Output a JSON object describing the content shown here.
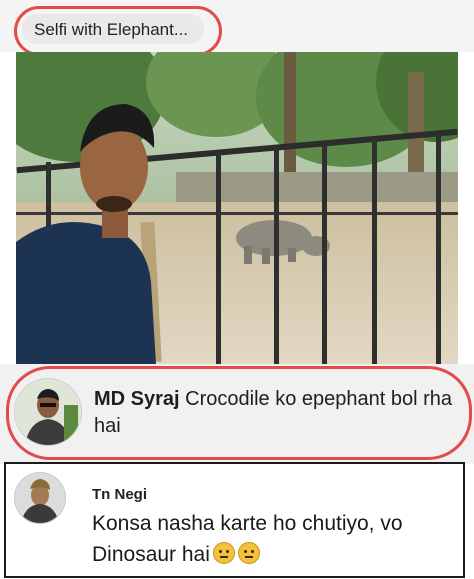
{
  "post": {
    "caption": "Selfi with Elephant..."
  },
  "comments": [
    {
      "author": "MD Syraj",
      "text": "Crocodile ko epephant bol rha hai"
    },
    {
      "author": "Tn Negi",
      "text": "Konsa nasha karte ho chutiyo, vo Dinosaur hai",
      "emojis": [
        "neutral-face-icon",
        "neutral-face-icon"
      ]
    }
  ],
  "colors": {
    "highlight_ring": "#e44a4a",
    "comment_bg": "#f1f1f1"
  }
}
